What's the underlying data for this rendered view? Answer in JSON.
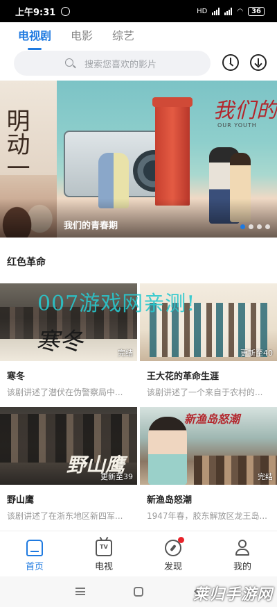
{
  "status_bar": {
    "time": "上午9:31",
    "network": "HD",
    "battery": "36"
  },
  "tabs": [
    {
      "label": "电视剧",
      "active": true
    },
    {
      "label": "电影",
      "active": false
    },
    {
      "label": "综艺",
      "active": false
    }
  ],
  "search": {
    "placeholder": "搜索您喜欢的影片"
  },
  "banner": {
    "caption": "我们的青春期",
    "side_text": "明动一夏",
    "title_art": "我们的青",
    "subtitle_art": "OUR YOUTH",
    "slide_count": 4,
    "active_slide": 1
  },
  "section": {
    "title": "红色革命"
  },
  "cards": [
    {
      "title": "寒冬",
      "desc": "该剧讲述了潜伏在伪警察局中...",
      "badge": "完结",
      "poster_text": "寒冬"
    },
    {
      "title": "王大花的革命生涯",
      "desc": "该剧讲述了一个来自于农村的...",
      "badge": "更新至40",
      "poster_text": ""
    },
    {
      "title": "野山鹰",
      "desc": "该剧讲述了在浙东地区新四军...",
      "badge": "更新至39",
      "poster_text": "野山鹰"
    },
    {
      "title": "新渔岛怒潮",
      "desc": "1947年春，胶东解放区龙王岛...",
      "badge": "完结",
      "poster_text": "新渔岛怒潮"
    }
  ],
  "watermark": "007游戏网亲测!",
  "bottom_nav": [
    {
      "label": "首页",
      "icon": "home-icon",
      "active": true
    },
    {
      "label": "电视",
      "icon": "tv-icon",
      "active": false
    },
    {
      "label": "发现",
      "icon": "compass-icon",
      "active": false,
      "dot": true
    },
    {
      "label": "我的",
      "icon": "user-icon",
      "active": false
    }
  ],
  "system_nav": {
    "watermark": "莱归手游网"
  },
  "colors": {
    "accent": "#1f7ae0",
    "badge_dot": "#e8232a",
    "watermark": "#28c8cd"
  }
}
